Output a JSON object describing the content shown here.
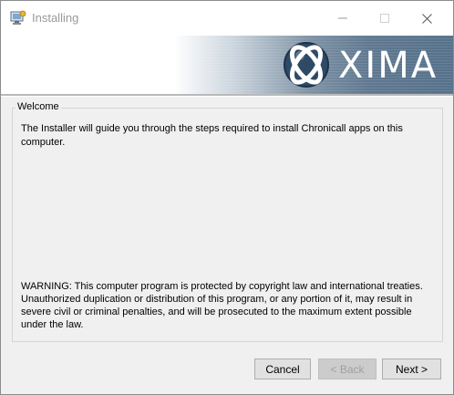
{
  "window": {
    "title": "Installing",
    "controls": {
      "minimize": "minimize-icon",
      "maximize": "maximize-icon",
      "close": "close-icon"
    }
  },
  "banner": {
    "logo_text": "XIMA",
    "colors": {
      "gradient_dark": "#56718b",
      "gradient_light": "#c9d3dc"
    }
  },
  "welcome": {
    "group_label": "Welcome",
    "intro": "The Installer will guide you through the steps required to install Chronicall apps on this computer.",
    "warning": "WARNING: This computer program is protected by copyright law and international treaties. Unauthorized duplication or distribution of this program, or any portion of it, may result in severe civil or criminal penalties, and will be prosecuted to the maximum extent possible under the law."
  },
  "buttons": {
    "cancel": "Cancel",
    "back": "< Back",
    "next": "Next >"
  }
}
